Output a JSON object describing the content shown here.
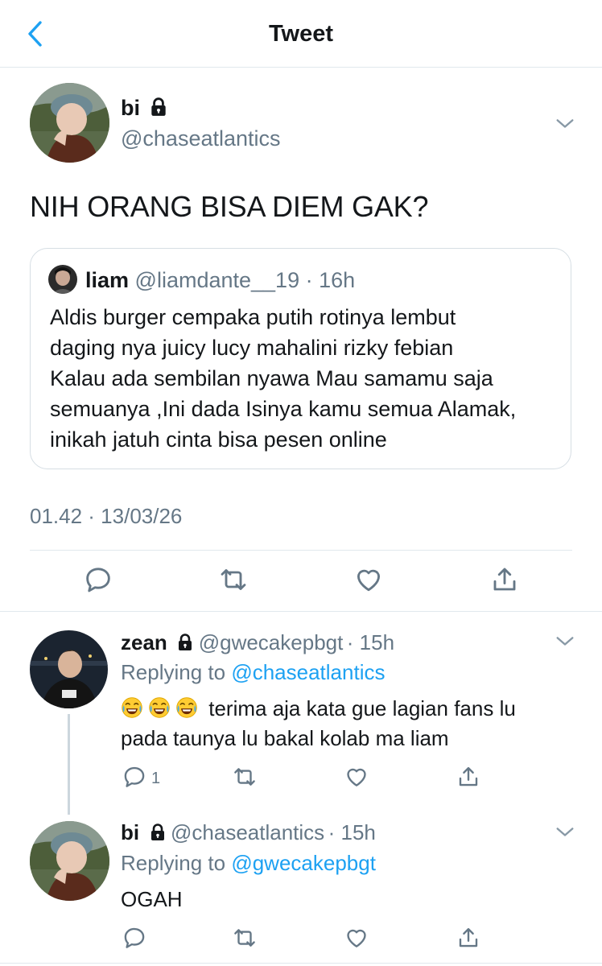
{
  "header": {
    "title": "Tweet"
  },
  "tweet": {
    "name": "bi",
    "handle": "@chaseatlantics",
    "text": "NIH ORANG BISA DIEM GAK?",
    "quote": {
      "name": "liam",
      "handle": "@liamdante__19",
      "time": "· 16h",
      "lines": [
        "Aldis burger cempaka putih rotinya lembut",
        "daging nya juicy lucy mahalini rizky febian",
        "Kalau ada sembilan nyawa Mau samamu saja",
        "semuanya ,Ini dada Isinya kamu semua Alamak,",
        "inikah jatuh cinta bisa pesen online"
      ]
    },
    "timestamp": "01.42 · 13/03/26"
  },
  "replies": [
    {
      "name": "zean",
      "handle": "@gwecakepbgt",
      "time": "· 15h",
      "replying_prefix": "Replying to",
      "replying_to": "@chaseatlantics",
      "line1": "terima aja kata gue lagian fans lu",
      "line2": "pada taunya lu bakal kolab ma liam",
      "reply_count": "1",
      "emoji": [
        "face-with-tears-of-joy",
        "face-with-tears-of-joy",
        "face-with-tears-of-joy"
      ]
    },
    {
      "name": "bi",
      "handle": "@chaseatlantics",
      "time": "· 15h",
      "replying_prefix": "Replying to",
      "replying_to": "@gwecakepbgt",
      "line1": "OGAH"
    }
  ],
  "colors": {
    "link": "#1da1f2",
    "secondary": "#657786",
    "divider": "#e1e8ed"
  },
  "icons": [
    "back-chevron-icon",
    "lock-icon",
    "chevron-down-icon",
    "reply-icon",
    "retweet-icon",
    "like-icon",
    "share-icon"
  ]
}
